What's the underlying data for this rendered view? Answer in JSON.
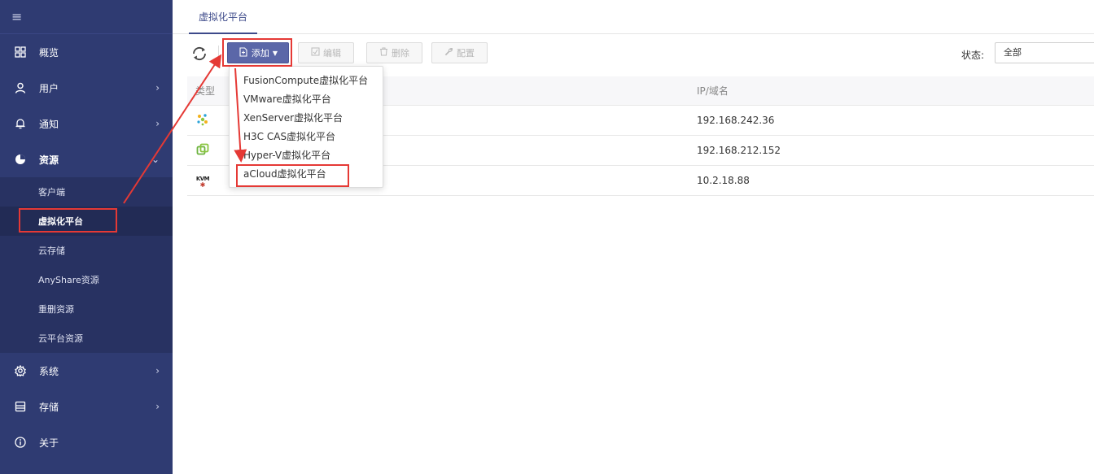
{
  "sidebar": {
    "top_icon": "hamburger-icon",
    "items": [
      {
        "label": "概览",
        "icon": "grid-icon",
        "chevron": ""
      },
      {
        "label": "用户",
        "icon": "user-icon",
        "chevron": "›"
      },
      {
        "label": "通知",
        "icon": "bell-icon",
        "chevron": "›"
      },
      {
        "label": "资源",
        "icon": "resource-icon",
        "chevron": "⌄"
      }
    ],
    "submenu": [
      {
        "label": "客户端"
      },
      {
        "label": "虚拟化平台"
      },
      {
        "label": "云存储"
      },
      {
        "label": "AnyShare资源"
      },
      {
        "label": "重删资源"
      },
      {
        "label": "云平台资源"
      }
    ],
    "bottom_items": [
      {
        "label": "系统",
        "icon": "gear-icon",
        "chevron": "›"
      },
      {
        "label": "存储",
        "icon": "storage-icon",
        "chevron": "›"
      },
      {
        "label": "关于",
        "icon": "info-icon",
        "chevron": ""
      }
    ]
  },
  "tab": {
    "label": "虚拟化平台"
  },
  "toolbar": {
    "add_label": "添加",
    "edit_label": "编辑",
    "delete_label": "删除",
    "config_label": "配置",
    "status_label": "状态:",
    "status_value": "全部"
  },
  "table": {
    "col_type": "类型",
    "col_ip": "IP/域名",
    "rows": [
      {
        "type_icon": "fusioncompute-icon",
        "ip": "192.168.242.36"
      },
      {
        "type_icon": "vmware-icon",
        "ip": "192.168.212.152"
      },
      {
        "type_icon": "kvm-icon",
        "icon_text": "KVM",
        "ip": "10.2.18.88"
      }
    ]
  },
  "dropdown": {
    "items": [
      "FusionCompute虚拟化平台",
      "VMware虚拟化平台",
      "XenServer虚拟化平台",
      "H3C CAS虚拟化平台",
      "Hyper-V虚拟化平台",
      "aCloud虚拟化平台"
    ]
  },
  "colors": {
    "sidebar_bg": "#2f3b72",
    "primary_button": "#5b67a8",
    "annotation_red": "#e53935"
  }
}
